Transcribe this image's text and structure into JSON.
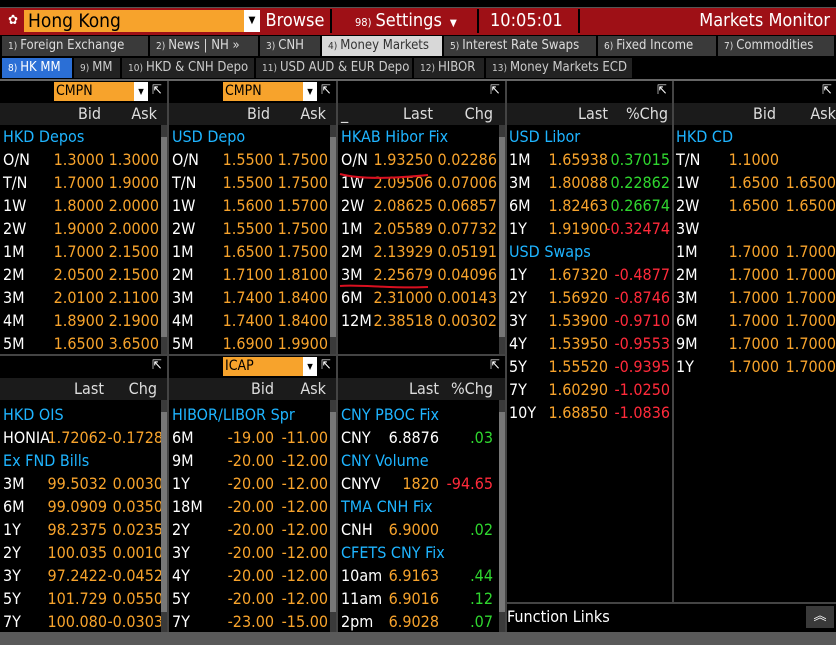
{
  "topbar": {
    "location": "Hong Kong",
    "browse": "Browse",
    "settings_num": "98)",
    "settings": "Settings",
    "time": "10:05:01",
    "title": "Markets Monitor"
  },
  "tabs_main": [
    {
      "n": "1)",
      "label": "Foreign Exchange"
    },
    {
      "n": "2)",
      "label": "News | NH »"
    },
    {
      "n": "3)",
      "label": "CNH"
    },
    {
      "n": "4)",
      "label": "Money Markets"
    },
    {
      "n": "5)",
      "label": "Interest Rate Swaps"
    },
    {
      "n": "6)",
      "label": "Fixed Income"
    },
    {
      "n": "7)",
      "label": "Commodities"
    }
  ],
  "tabs_sub": [
    {
      "n": "8)",
      "label": "HK MM"
    },
    {
      "n": "9)",
      "label": "MM"
    },
    {
      "n": "10)",
      "label": "HKD & CNH Depo"
    },
    {
      "n": "11)",
      "label": "USD AUD & EUR Depo"
    },
    {
      "n": "12)",
      "label": "HIBOR"
    },
    {
      "n": "13)",
      "label": "Money Markets ECD"
    }
  ],
  "p1": {
    "source": "CMPN",
    "col1": "Bid",
    "col2": "Ask",
    "section": "HKD Depos",
    "rows": [
      {
        "t": "O/N",
        "a": "1.3000",
        "b": "1.3000"
      },
      {
        "t": "T/N",
        "a": "1.7000",
        "b": "1.9000"
      },
      {
        "t": "1W",
        "a": "1.8000",
        "b": "2.0000"
      },
      {
        "t": "2W",
        "a": "1.9000",
        "b": "2.0000"
      },
      {
        "t": "1M",
        "a": "1.7000",
        "b": "2.1500"
      },
      {
        "t": "2M",
        "a": "2.0500",
        "b": "2.1500"
      },
      {
        "t": "3M",
        "a": "2.0100",
        "b": "2.1100"
      },
      {
        "t": "4M",
        "a": "1.8900",
        "b": "2.1900"
      },
      {
        "t": "5M",
        "a": "1.6500",
        "b": "3.6500"
      }
    ]
  },
  "p2": {
    "source": "CMPN",
    "col1": "Bid",
    "col2": "Ask",
    "section": "USD Depo",
    "rows": [
      {
        "t": "O/N",
        "a": "1.5500",
        "b": "1.7500"
      },
      {
        "t": "T/N",
        "a": "1.5500",
        "b": "1.7500"
      },
      {
        "t": "1W",
        "a": "1.5600",
        "b": "1.5700"
      },
      {
        "t": "2W",
        "a": "1.5500",
        "b": "1.7500"
      },
      {
        "t": "1M",
        "a": "1.6500",
        "b": "1.7500"
      },
      {
        "t": "2M",
        "a": "1.7100",
        "b": "1.8100"
      },
      {
        "t": "3M",
        "a": "1.7400",
        "b": "1.8400"
      },
      {
        "t": "4M",
        "a": "1.7400",
        "b": "1.8400"
      },
      {
        "t": "5M",
        "a": "1.6900",
        "b": "1.9900"
      }
    ]
  },
  "p3": {
    "col0": "_",
    "col1": "Last",
    "col2": "Chg",
    "section": "HKAB Hibor Fix",
    "rows": [
      {
        "t": "O/N",
        "a": "1.93250",
        "b": "0.02286"
      },
      {
        "t": "1W",
        "a": "2.09506",
        "b": "0.07006"
      },
      {
        "t": "2W",
        "a": "2.08625",
        "b": "0.06857"
      },
      {
        "t": "1M",
        "a": "2.05589",
        "b": "0.07732"
      },
      {
        "t": "2M",
        "a": "2.13929",
        "b": "0.05191"
      },
      {
        "t": "3M",
        "a": "2.25679",
        "b": "0.04096"
      },
      {
        "t": "6M",
        "a": "2.31000",
        "b": "0.00143"
      },
      {
        "t": "12M",
        "a": "2.38518",
        "b": "0.00302"
      }
    ]
  },
  "p4": {
    "col1": "Last",
    "col2": "%Chg",
    "section1": "USD Libor",
    "libor": [
      {
        "t": "1M",
        "a": "1.65938",
        "b": "0.37015"
      },
      {
        "t": "3M",
        "a": "1.80088",
        "b": "0.22862"
      },
      {
        "t": "6M",
        "a": "1.82463",
        "b": "0.26674"
      },
      {
        "t": "1Y",
        "a": "1.91900",
        "b": "-0.32474"
      }
    ],
    "section2": "USD Swaps",
    "swaps": [
      {
        "t": "1Y",
        "a": "1.67320",
        "b": "-0.4877"
      },
      {
        "t": "2Y",
        "a": "1.56920",
        "b": "-0.8746"
      },
      {
        "t": "3Y",
        "a": "1.53900",
        "b": "-0.9710"
      },
      {
        "t": "4Y",
        "a": "1.53950",
        "b": "-0.9553"
      },
      {
        "t": "5Y",
        "a": "1.55520",
        "b": "-0.9395"
      },
      {
        "t": "7Y",
        "a": "1.60290",
        "b": "-1.0250"
      },
      {
        "t": "10Y",
        "a": "1.68850",
        "b": "-1.0836"
      }
    ],
    "function_links": "Function Links"
  },
  "p5": {
    "col1": "Bid",
    "col2": "Ask",
    "section": "HKD CD",
    "rows": [
      {
        "t": "T/N",
        "a": "1.1000",
        "b": ""
      },
      {
        "t": "1W",
        "a": "1.6500",
        "b": "1.6500"
      },
      {
        "t": "2W",
        "a": "1.6500",
        "b": "1.6500"
      },
      {
        "t": "3W",
        "a": "",
        "b": ""
      },
      {
        "t": "1M",
        "a": "1.7000",
        "b": "1.7000"
      },
      {
        "t": "2M",
        "a": "1.7000",
        "b": "1.7000"
      },
      {
        "t": "3M",
        "a": "1.7000",
        "b": "1.7000"
      },
      {
        "t": "6M",
        "a": "1.7000",
        "b": "1.7000"
      },
      {
        "t": "9M",
        "a": "1.7000",
        "b": "1.7000"
      },
      {
        "t": "1Y",
        "a": "1.7000",
        "b": "1.7000"
      }
    ]
  },
  "p6": {
    "col1": "Last",
    "col2": "Chg",
    "section1": "HKD OIS",
    "ois": [
      {
        "t": "HONIA",
        "a": "1.72062",
        "b": "-0.1728"
      }
    ],
    "section2": "Ex FND Bills",
    "bills": [
      {
        "t": "3M",
        "a": "99.5032",
        "b": "0.0030"
      },
      {
        "t": "6M",
        "a": "99.0909",
        "b": "0.0350"
      },
      {
        "t": "1Y",
        "a": "98.2375",
        "b": "0.0235"
      },
      {
        "t": "2Y",
        "a": "100.035",
        "b": "0.0010"
      },
      {
        "t": "3Y",
        "a": "97.2422",
        "b": "-0.0452"
      },
      {
        "t": "5Y",
        "a": "101.729",
        "b": "0.0550"
      },
      {
        "t": "7Y",
        "a": "100.080",
        "b": "-0.0303"
      }
    ]
  },
  "p7": {
    "source": "ICAP",
    "col1": "Bid",
    "col2": "Ask",
    "section": "HIBOR/LIBOR Spr",
    "rows": [
      {
        "t": "6M",
        "a": "-19.00",
        "b": "-11.00"
      },
      {
        "t": "9M",
        "a": "-20.00",
        "b": "-12.00"
      },
      {
        "t": "1Y",
        "a": "-20.00",
        "b": "-12.00"
      },
      {
        "t": "18M",
        "a": "-20.00",
        "b": "-12.00"
      },
      {
        "t": "2Y",
        "a": "-20.00",
        "b": "-12.00"
      },
      {
        "t": "3Y",
        "a": "-20.00",
        "b": "-12.00"
      },
      {
        "t": "4Y",
        "a": "-20.00",
        "b": "-12.00"
      },
      {
        "t": "5Y",
        "a": "-20.00",
        "b": "-12.00"
      },
      {
        "t": "7Y",
        "a": "-23.00",
        "b": "-15.00"
      }
    ]
  },
  "p8": {
    "col1": "Last",
    "col2": "%Chg",
    "s1": "CNY PBOC Fix",
    "r1": {
      "t": "CNY",
      "a": "6.8876",
      "b": ".03"
    },
    "s2": "CNY Volume",
    "r2": {
      "t": "CNYV",
      "a": "1820",
      "b": "-94.65"
    },
    "s3": "TMA CNH Fix",
    "r3": {
      "t": "CNH",
      "a": "6.9000",
      "b": ".02"
    },
    "s4": "CFETS CNY Fix",
    "r4": [
      {
        "t": "10am",
        "a": "6.9163",
        "b": ".44"
      },
      {
        "t": "11am",
        "a": "6.9016",
        "b": ".12"
      },
      {
        "t": "2pm",
        "a": "6.9028",
        "b": ".07"
      }
    ]
  },
  "colors": {
    "accent_orange": "#f7a32c",
    "topbar_red": "#9e1016",
    "section_blue": "#1eb4ff",
    "up_green": "#2fd62f",
    "down_red": "#ff2a3a",
    "annotation_red": "#d91020"
  },
  "icons": {
    "location": "bauhinia-icon",
    "popout": "popout-icon",
    "scroll_top": "double-chevron-up-icon"
  }
}
